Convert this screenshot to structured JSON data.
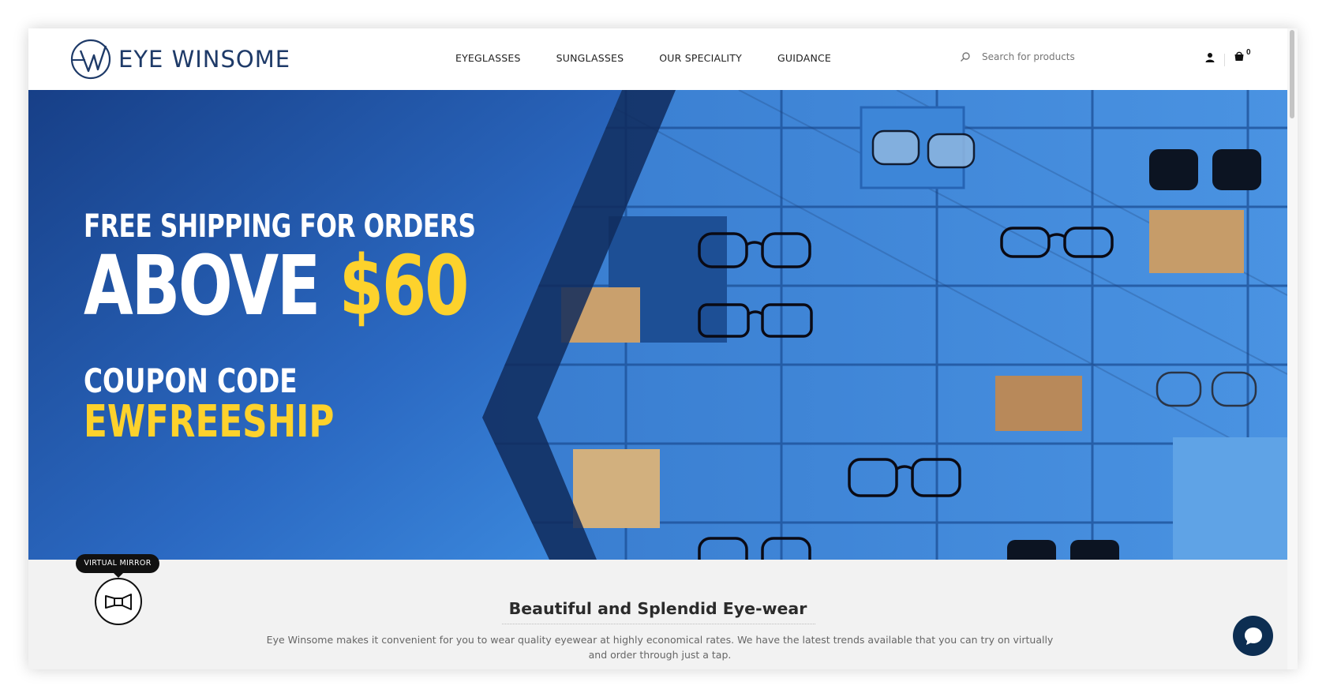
{
  "brand": {
    "name": "EYE WINSOME"
  },
  "nav": {
    "items": [
      {
        "label": "EYEGLASSES"
      },
      {
        "label": "SUNGLASSES"
      },
      {
        "label": "OUR SPECIALITY"
      },
      {
        "label": "GUIDANCE"
      }
    ]
  },
  "search": {
    "placeholder": "Search for products"
  },
  "cart": {
    "count": "0"
  },
  "banner": {
    "line1": "FREE SHIPPING FOR ORDERS",
    "line2_prefix": "ABOVE",
    "line2_amount": "$60",
    "line3": "COUPON CODE",
    "line4": "EWFREESHIP"
  },
  "section": {
    "title": "Beautiful and Splendid Eye-wear",
    "description": "Eye Winsome makes it convenient for you to wear quality eyewear at highly economical rates. We have the latest trends available that you can try on virtually and order through just a tap."
  },
  "virtual_mirror": {
    "label": "VIRTUAL MIRROR"
  },
  "colors": {
    "brand_navy": "#1e3a68",
    "accent_yellow": "#fdd22c",
    "banner_blue": "#2f75c9",
    "chat_navy": "#0d2e52"
  },
  "icons": [
    "logo-mark-icon",
    "search-icon",
    "user-icon",
    "cart-icon",
    "mirror-icon",
    "chat-icon"
  ]
}
